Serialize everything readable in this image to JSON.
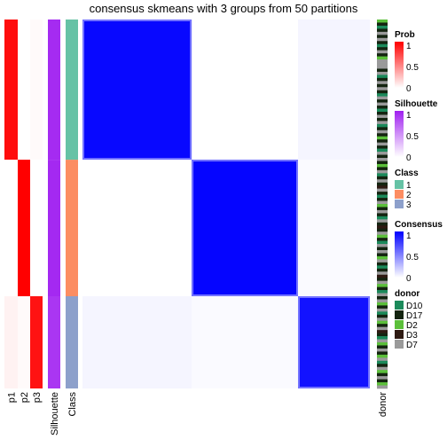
{
  "chart_data": {
    "type": "heatmap",
    "title": "consensus skmeans with 3 groups from 50 partitions",
    "column_annotation_labels": [
      "p1",
      "p2",
      "p3",
      "Silhouette",
      "Class"
    ],
    "row_annotation_label": "donor",
    "groups": [
      {
        "class": 1,
        "fraction_of_samples": 0.38,
        "p1": 0.95,
        "p2": 0.0,
        "p3": 0.02,
        "silhouette": 0.95,
        "within_consensus": 0.97
      },
      {
        "class": 2,
        "fraction_of_samples": 0.37,
        "p1": 0.0,
        "p2": 1.0,
        "p3": 0.0,
        "silhouette": 0.96,
        "within_consensus": 0.98
      },
      {
        "class": 3,
        "fraction_of_samples": 0.25,
        "p1": 0.05,
        "p2": 0.02,
        "p3": 0.93,
        "silhouette": 0.9,
        "within_consensus": 0.93
      }
    ],
    "between_consensus": [
      [
        0.97,
        0.0,
        0.04
      ],
      [
        0.0,
        0.98,
        0.02
      ],
      [
        0.04,
        0.02,
        0.93
      ]
    ],
    "legends": [
      {
        "title": "Prob",
        "type": "continuous",
        "ticks": [
          "1",
          "0.5",
          "0"
        ],
        "color_low": "#ffffff",
        "color_high": "#ff0000"
      },
      {
        "title": "Silhouette",
        "type": "continuous",
        "ticks": [
          "1",
          "0.5",
          "0"
        ],
        "color_low": "#ffffff",
        "color_high": "#a020f0"
      },
      {
        "title": "Class",
        "type": "discrete",
        "items": [
          {
            "label": "1",
            "color": "#66c2a5"
          },
          {
            "label": "2",
            "color": "#fc8d62"
          },
          {
            "label": "3",
            "color": "#8da0cb"
          }
        ]
      },
      {
        "title": "Consensus",
        "type": "continuous",
        "ticks": [
          "1",
          "0.5",
          "0"
        ],
        "color_low": "#ffffff",
        "color_high": "#0000ff"
      },
      {
        "title": "donor",
        "type": "discrete",
        "items": [
          {
            "label": "D10",
            "color": "#1b8a5a"
          },
          {
            "label": "D17",
            "color": "#142410"
          },
          {
            "label": "D2",
            "color": "#5bbf3a"
          },
          {
            "label": "D3",
            "color": "#2e1a12"
          },
          {
            "label": "D7",
            "color": "#9a9a9a"
          }
        ]
      }
    ],
    "donor_color_sequence": [
      "D2",
      "D17",
      "D10",
      "D17",
      "D7",
      "D17",
      "D7",
      "D17",
      "D10",
      "D17",
      "D7",
      "D17",
      "D2",
      "D7",
      "D7",
      "D7",
      "D17",
      "D7",
      "D10",
      "D17",
      "D7",
      "D17",
      "D7",
      "D17",
      "D10",
      "D7",
      "D17",
      "D7",
      "D17",
      "D10",
      "D17",
      "D7",
      "D17",
      "D7",
      "D10",
      "D17",
      "D7",
      "D17",
      "D2",
      "D17",
      "D7",
      "D17",
      "D10",
      "D7",
      "D17",
      "D7",
      "D17",
      "D2",
      "D17",
      "D7",
      "D10",
      "D17",
      "D7",
      "D17",
      "D3",
      "D7",
      "D17",
      "D10",
      "D17",
      "D7",
      "D2",
      "D17",
      "D7",
      "D17",
      "D10",
      "D7",
      "D17",
      "D3",
      "D17",
      "D7",
      "D2",
      "D17",
      "D10",
      "D7",
      "D17",
      "D7",
      "D17",
      "D2",
      "D7",
      "D17",
      "D10",
      "D17",
      "D7",
      "D3",
      "D17",
      "D7",
      "D2",
      "D17",
      "D10",
      "D7",
      "D17",
      "D7",
      "D2",
      "D17",
      "D7",
      "D10",
      "D17",
      "D7",
      "D2",
      "D17",
      "D7",
      "D3",
      "D17",
      "D10",
      "D7",
      "D2",
      "D17",
      "D7",
      "D17",
      "D2",
      "D7",
      "D10",
      "D17",
      "D7",
      "D2",
      "D17",
      "D7",
      "D17",
      "D2",
      "D7"
    ]
  }
}
